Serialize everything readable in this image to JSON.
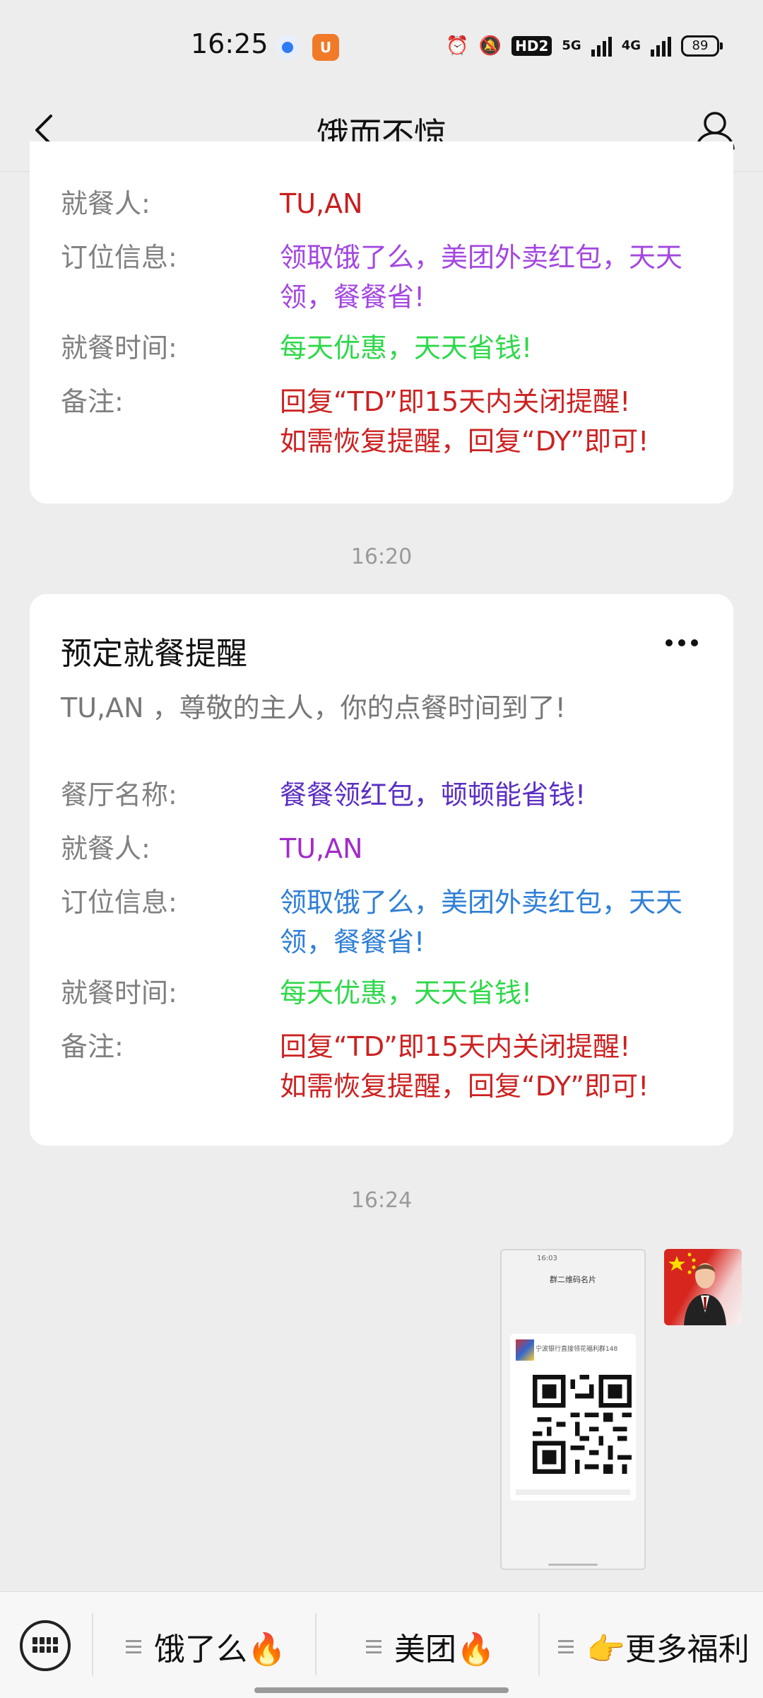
{
  "status_bar": {
    "time": "16:25",
    "hd_label": "HD2",
    "net1": "5G",
    "net2": "4G",
    "battery": "89"
  },
  "nav": {
    "title": "饿而不惊"
  },
  "card1": {
    "rows": [
      {
        "label": "就餐人:",
        "value": "TU,AN",
        "color": "#c81e1e"
      },
      {
        "label": "订位信息:",
        "value": "领取饿了么，美团外卖红包，天天领，餐餐省!",
        "color": "#a347e0"
      },
      {
        "label": "就餐时间:",
        "value": "每天优惠，天天省钱!",
        "color": "#2ed84a"
      },
      {
        "label": "备注:",
        "value": "回复“TD”即15天内关闭提醒!",
        "value2": "如需恢复提醒，回复“DY”即可!",
        "color": "#cc2222"
      }
    ]
  },
  "timestamp1": "16:20",
  "card2": {
    "title": "预定就餐提醒",
    "subtitle": "TU,AN ，尊敬的主人，你的点餐时间到了!",
    "rows": [
      {
        "label": "餐厅名称:",
        "value": "餐餐领红包，顿顿能省钱!",
        "color": "#5a2fc2"
      },
      {
        "label": "就餐人:",
        "value": "TU,AN",
        "color": "#a22bc9"
      },
      {
        "label": "订位信息:",
        "value": "领取饿了么，美团外卖红包，天天领，餐餐省!",
        "color": "#2f7fd6"
      },
      {
        "label": "就餐时间:",
        "value": "每天优惠，天天省钱!",
        "color": "#2ed84a"
      },
      {
        "label": "备注:",
        "value": "回复“TD”即15天内关闭提醒!",
        "value2": "如需恢复提醒，回复“DY”即可!",
        "color": "#cc2222"
      }
    ]
  },
  "timestamp2": "16:24",
  "image_message": {
    "top_time": "16:03",
    "header": "群二维码名片",
    "card_title": "宁波银行直接领花福利群148"
  },
  "bottom_menu": {
    "items": [
      {
        "label": "饿了么🔥"
      },
      {
        "label": "美团🔥"
      },
      {
        "label": "👉更多福利"
      }
    ]
  }
}
